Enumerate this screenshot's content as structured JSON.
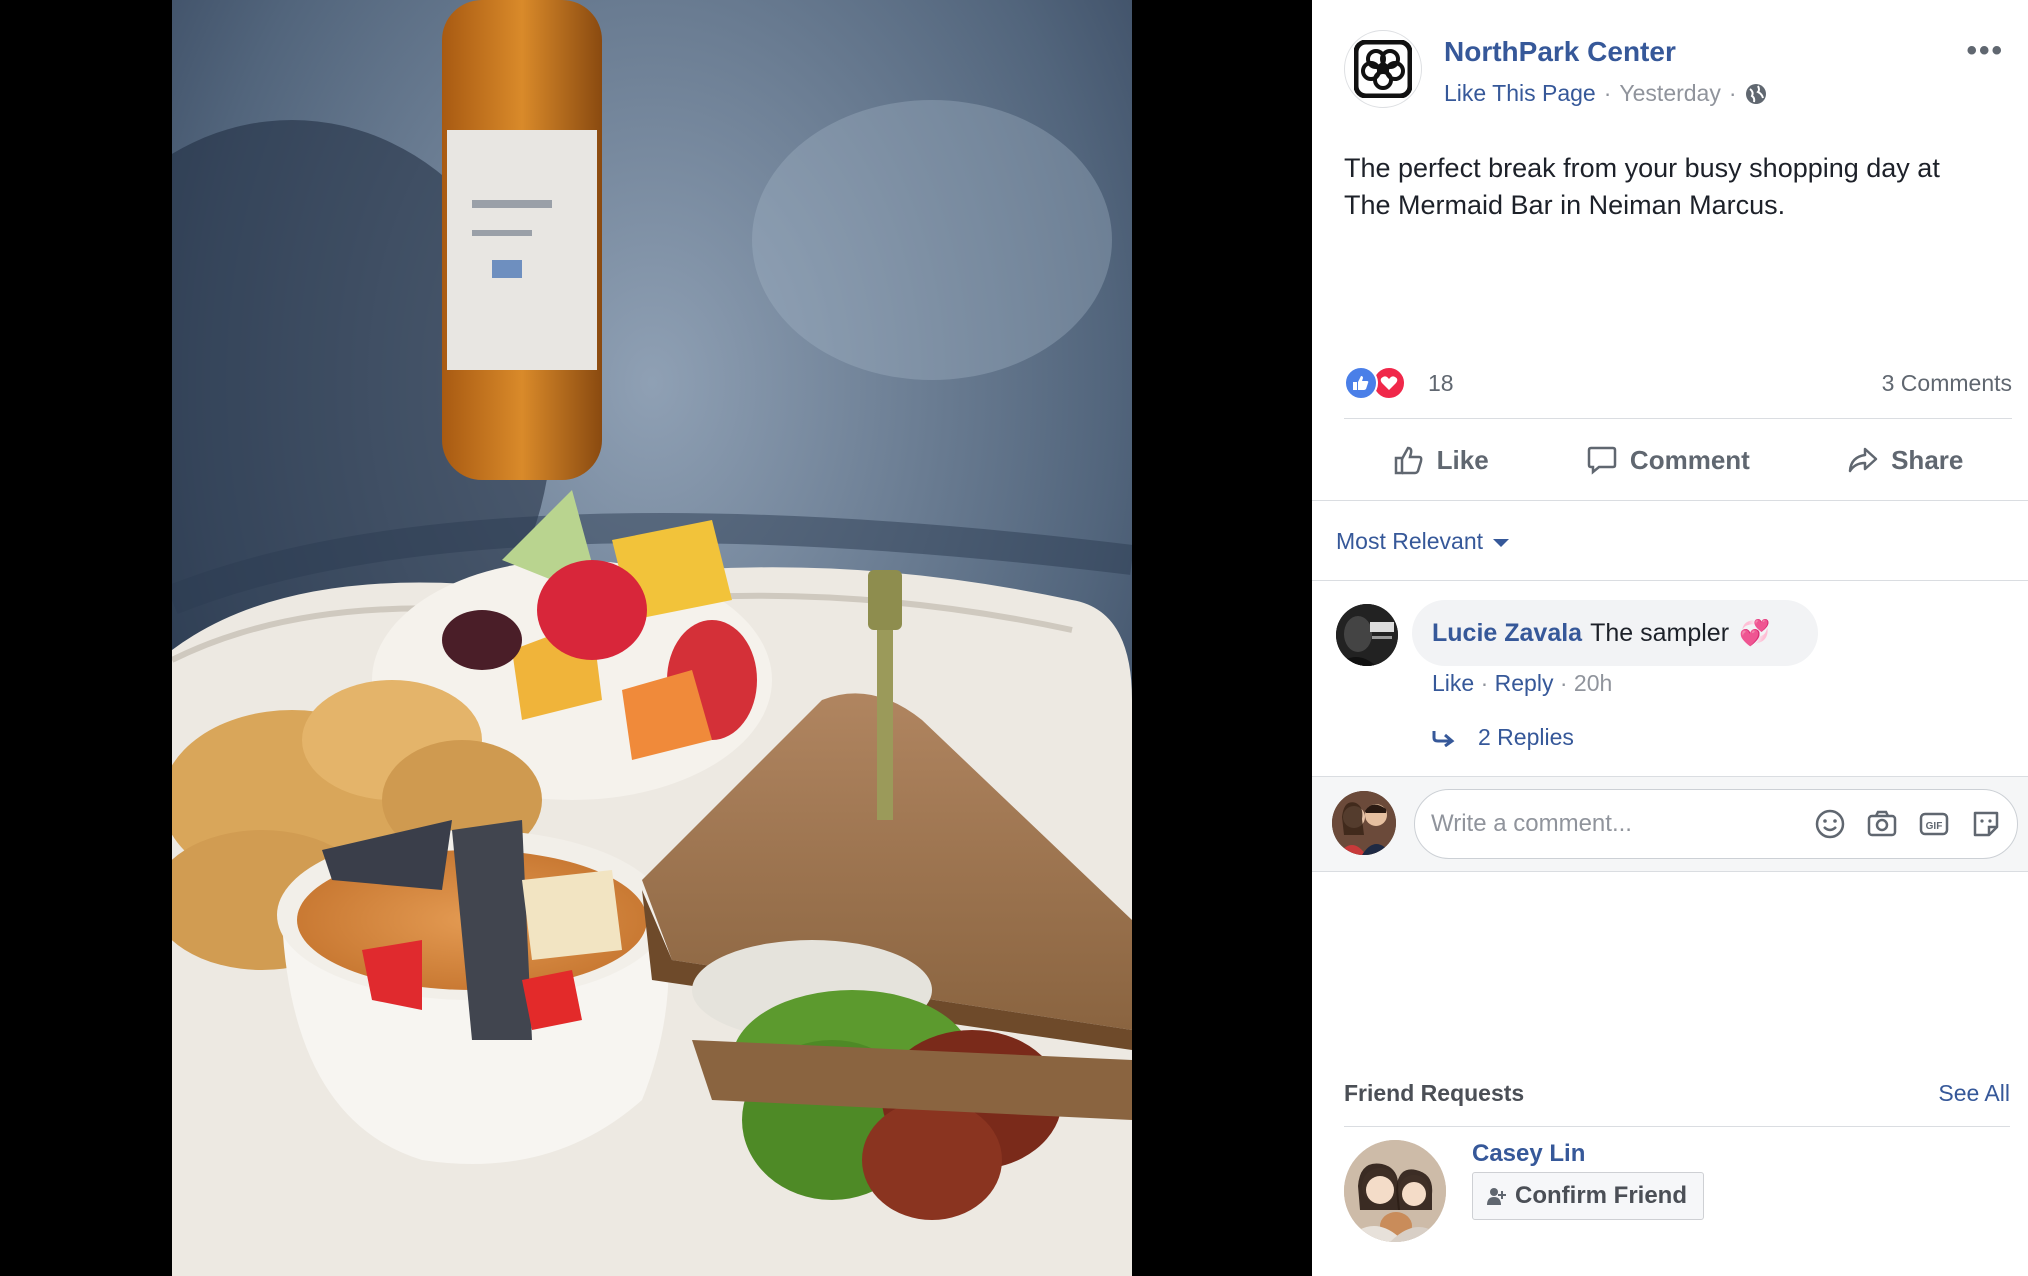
{
  "page": {
    "name": "NorthPark Center",
    "like_page_label": "Like This Page",
    "timestamp": "Yesterday",
    "audience_icon": "globe-icon"
  },
  "post": {
    "text": "The perfect break from your busy shopping day at The Mermaid Bar in Neiman Marcus."
  },
  "reactions": {
    "types": [
      "like",
      "love"
    ],
    "count": "18",
    "comments_count": "3 Comments"
  },
  "actions": {
    "like": "Like",
    "comment": "Comment",
    "share": "Share"
  },
  "sort": {
    "label": "Most Relevant"
  },
  "comments": [
    {
      "author": "Lucie Zavala",
      "text": "The sampler",
      "emoji": "💞",
      "like_label": "Like",
      "reply_label": "Reply",
      "time": "20h",
      "replies_label": "2 Replies"
    }
  ],
  "composer": {
    "placeholder": "Write a comment...",
    "icons": [
      "emoji-icon",
      "camera-icon",
      "gif-icon",
      "sticker-icon"
    ]
  },
  "friend_requests": {
    "title": "Friend Requests",
    "see_all": "See All",
    "items": [
      {
        "name": "Casey Lin",
        "confirm_label": "Confirm Friend"
      }
    ]
  },
  "colors": {
    "link": "#365899",
    "like_blue": "#4a7fe8",
    "love_red": "#f0284a",
    "muted": "#90949c"
  }
}
